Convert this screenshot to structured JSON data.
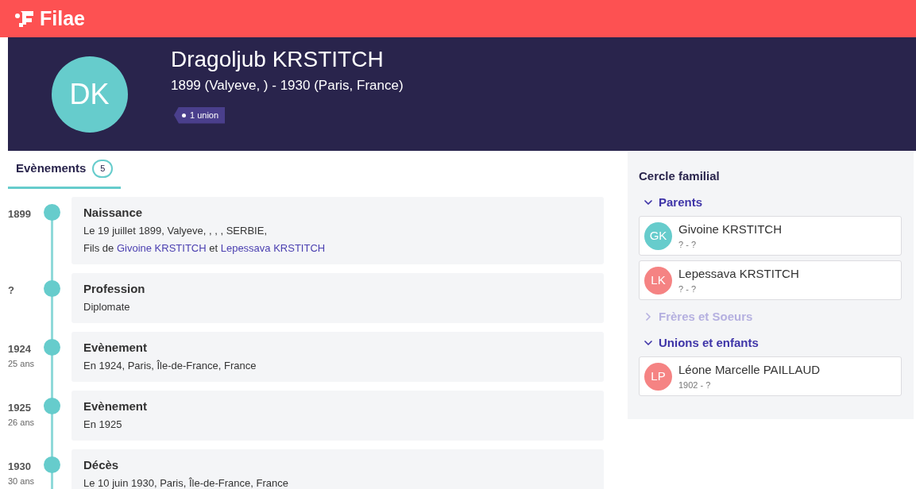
{
  "brand": {
    "name": "Filae"
  },
  "person": {
    "initials": "DK",
    "name": "Dragoljub KRSTITCH",
    "dates": "1899 (Valyeve, ) - 1930 (Paris, France)",
    "badge": "1 union"
  },
  "tabs": [
    {
      "label": "Evènements",
      "count": "5",
      "selected": true
    }
  ],
  "events": [
    {
      "year": "1899",
      "title": "Naissance",
      "lines": [
        [
          {
            "kind": "text",
            "text": "Le 19 juillet 1899, Valyeve, , , , SERBIE,"
          }
        ],
        [
          {
            "kind": "text",
            "text": "Fils de "
          },
          {
            "kind": "link",
            "text": "Givoine KRSTITCH"
          },
          {
            "kind": "text",
            "text": " et "
          },
          {
            "kind": "link",
            "text": "Lepessava KRSTITCH"
          }
        ]
      ]
    },
    {
      "year": "?",
      "title": "Profession",
      "lines": [
        [
          {
            "kind": "text",
            "text": "Diplomate"
          }
        ]
      ]
    },
    {
      "year": "1924",
      "age": "25 ans",
      "title": "Evènement",
      "lines": [
        [
          {
            "kind": "text",
            "text": "En 1924, Paris, Île-de-France, France"
          }
        ]
      ]
    },
    {
      "year": "1925",
      "age": "26 ans",
      "title": "Evènement",
      "lines": [
        [
          {
            "kind": "text",
            "text": "En 1925"
          }
        ]
      ]
    },
    {
      "year": "1930",
      "age": "30 ans",
      "title": "Décès",
      "lines": [
        [
          {
            "kind": "text",
            "text": "Le 10 juin 1930, Paris, Île-de-France, France"
          }
        ]
      ]
    }
  ],
  "family": {
    "title": "Cercle familial",
    "sections": [
      {
        "label": "Parents",
        "expanded": true,
        "disabled": false,
        "people": [
          {
            "initials": "GK",
            "name": "Givoine KRSTITCH",
            "dates": "? - ?",
            "color": "#66cccc"
          },
          {
            "initials": "LK",
            "name": "Lepessava KRSTITCH",
            "dates": "? - ?",
            "color": "#f58383"
          }
        ]
      },
      {
        "label": "Frères et Soeurs",
        "expanded": false,
        "disabled": true
      },
      {
        "label": "Unions et enfants",
        "expanded": true,
        "disabled": false,
        "people": [
          {
            "initials": "LP",
            "name": "Léone Marcelle PAILLAUD",
            "dates": "1902 - ?",
            "color": "#f58383"
          }
        ]
      }
    ]
  }
}
